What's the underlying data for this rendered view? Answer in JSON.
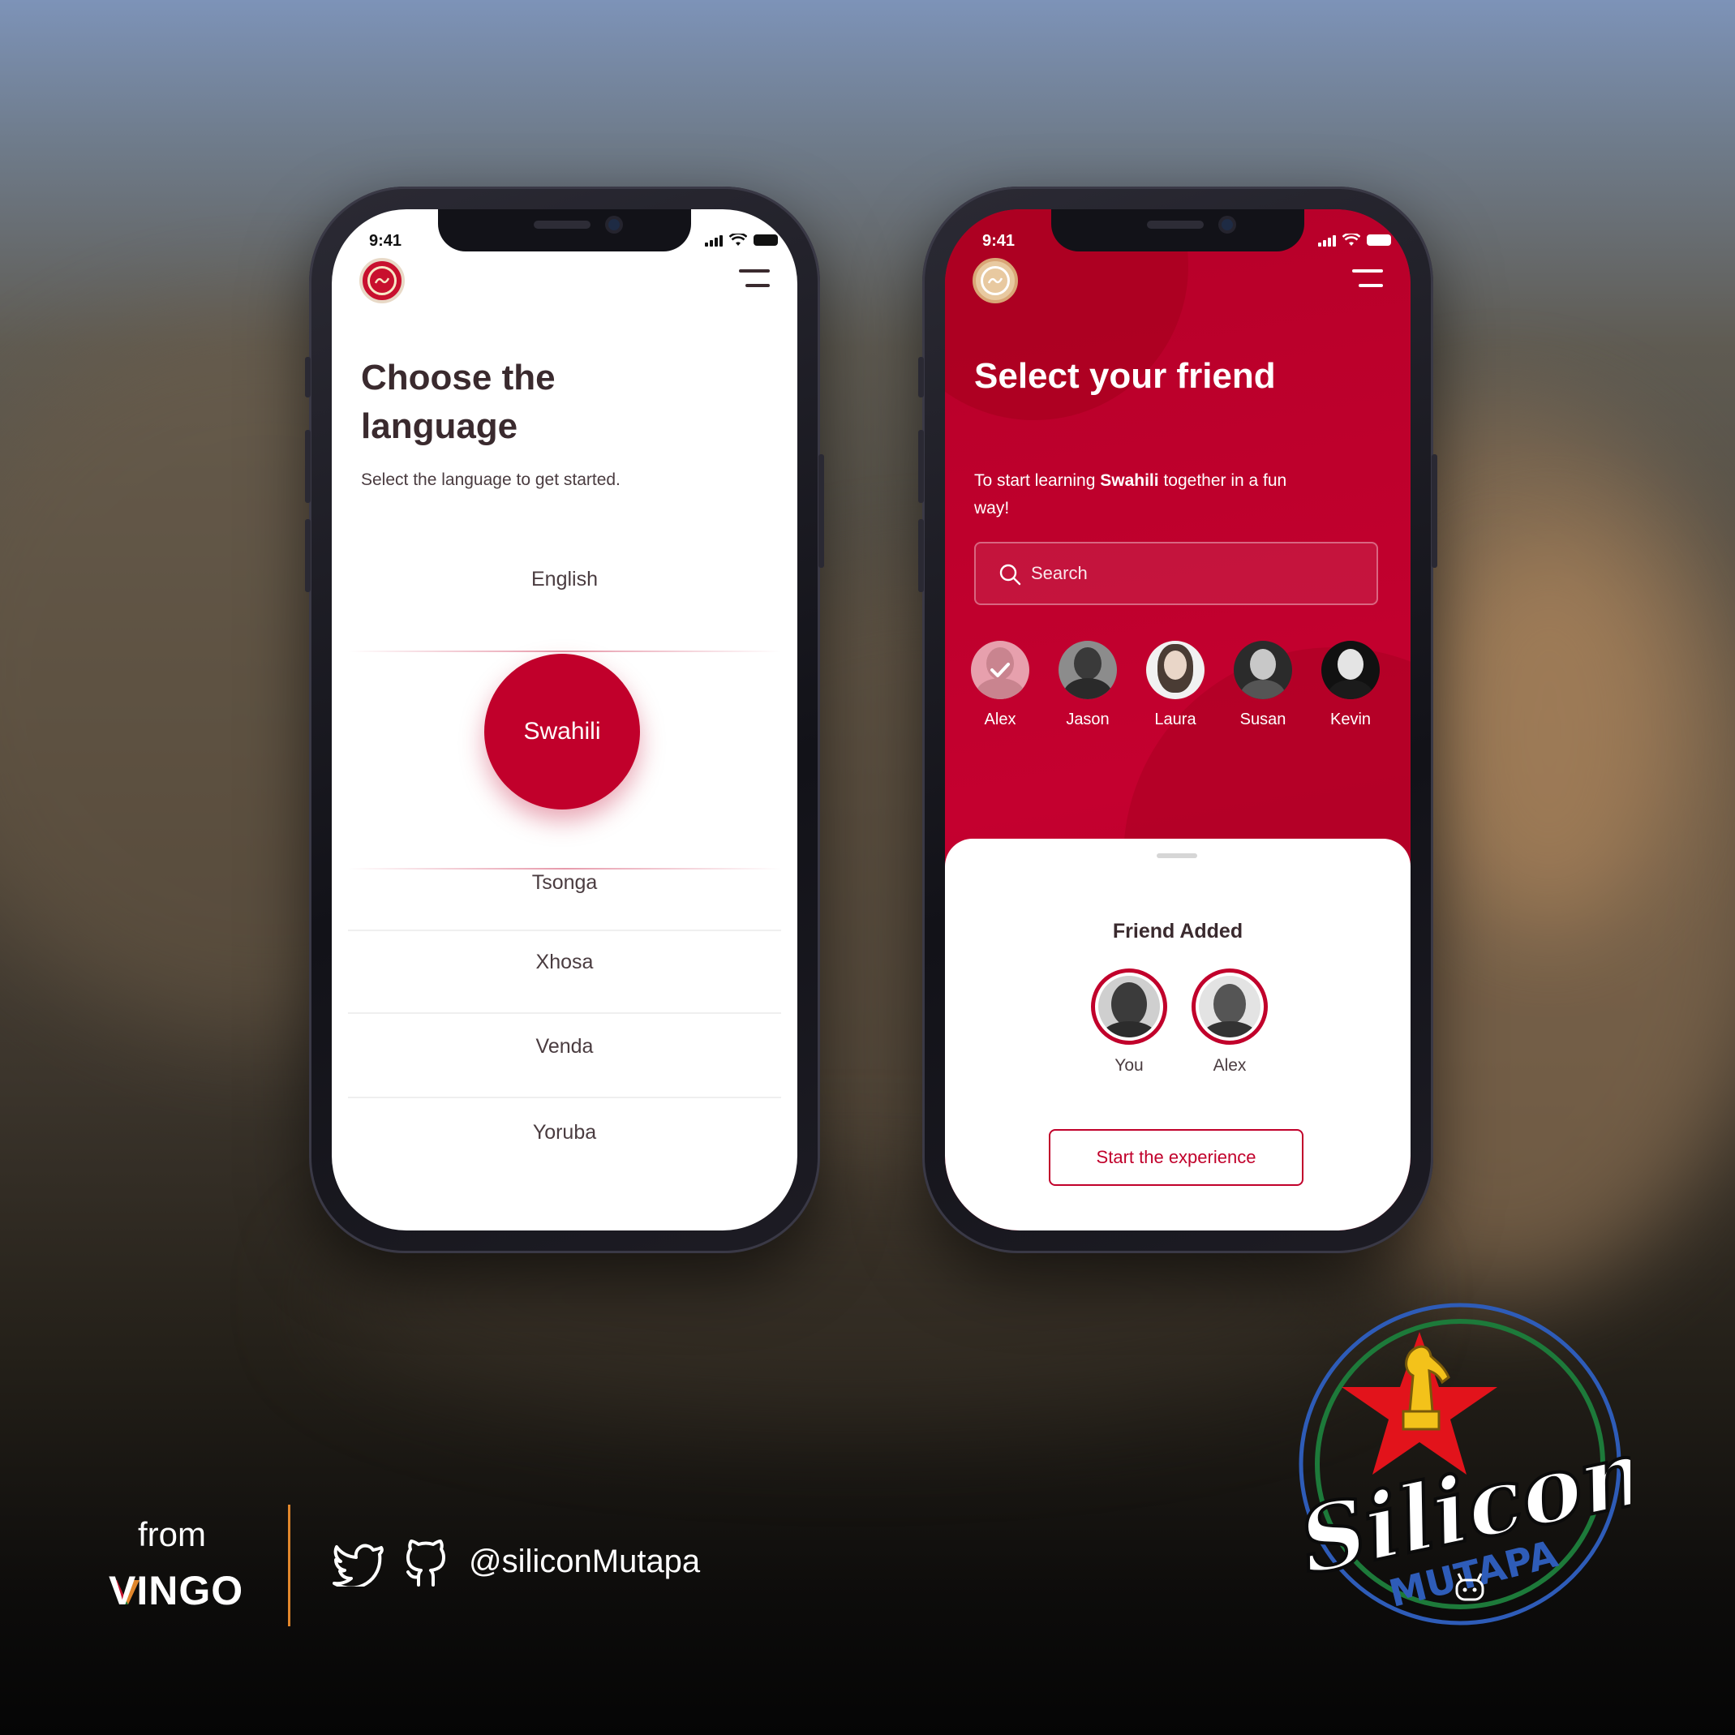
{
  "status_time": "9:41",
  "screen1": {
    "title": "Choose the language",
    "subtitle": "Select the language to get started.",
    "languages": [
      "English",
      "Swahili",
      "Tsonga",
      "Xhosa",
      "Venda",
      "Yoruba"
    ],
    "selected_language": "Swahili"
  },
  "screen2": {
    "title": "Select your friend",
    "subtitle_prefix": "To start learning ",
    "subtitle_bold": "Swahili",
    "subtitle_suffix": " together in a fun way!",
    "search_placeholder": "Search",
    "friends": [
      "Alex",
      "Jason",
      "Laura",
      "Susan",
      "Kevin"
    ],
    "selected_friend": "Alex",
    "sheet": {
      "title": "Friend Added",
      "added": [
        "You",
        "Alex"
      ],
      "cta": "Start the experience"
    }
  },
  "footer": {
    "from_label": "from",
    "brand": "VINGO",
    "handle": "@siliconMutapa",
    "icons": [
      "twitter-icon",
      "github-icon"
    ]
  },
  "badge": {
    "line1": "Silicon",
    "line2": "MUTAPA"
  },
  "colors": {
    "accent": "#c1002b",
    "divider_orange": "#e0862b",
    "badge_blue": "#2e5cb8",
    "badge_green": "#1d7a3a",
    "badge_red": "#e2131b",
    "badge_yellow": "#f3c21a"
  }
}
